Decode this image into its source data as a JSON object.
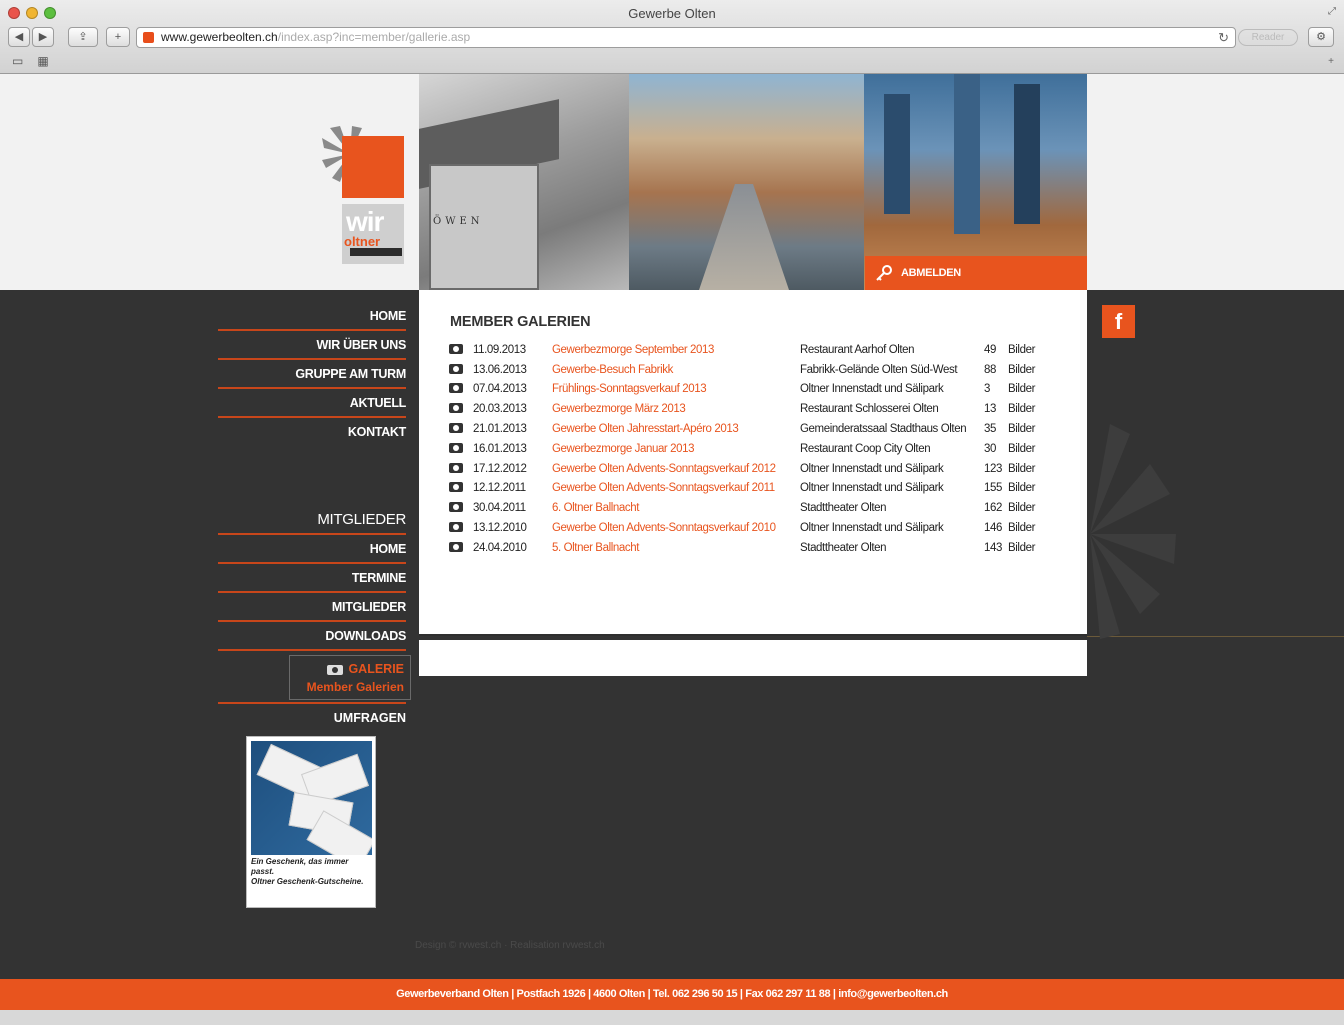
{
  "browser": {
    "window_title": "Gewerbe Olten",
    "url_domain": "www.gewerbeolten.ch",
    "url_path": "/index.asp?inc=member/gallerie.asp",
    "reader_label": "Reader"
  },
  "header": {
    "login_label": "ABMELDEN",
    "logo_word": "wir",
    "logo_sub": "oltner"
  },
  "nav_main": [
    {
      "label": "HOME"
    },
    {
      "label": "WIR ÜBER UNS"
    },
    {
      "label": "GRUPPE AM TURM"
    },
    {
      "label": "AKTUELL"
    },
    {
      "label": "KONTAKT"
    }
  ],
  "members_heading": "MITGLIEDER",
  "nav_members": [
    {
      "label": "HOME"
    },
    {
      "label": "TERMINE"
    },
    {
      "label": "MITGLIEDER"
    },
    {
      "label": "DOWNLOADS"
    }
  ],
  "gallery_nav": {
    "label": "GALERIE",
    "sublabel": "Member Galerien"
  },
  "umfragen_label": "UMFRAGEN",
  "voucher": {
    "caption_line1": "Ein Geschenk, das immer passt.",
    "caption_line2": "Oltner Geschenk-Gutscheine."
  },
  "content": {
    "title": "MEMBER GALERIEN",
    "rows": [
      {
        "date": "11.09.2013",
        "event": "Gewerbezmorge September 2013",
        "location": "Restaurant Aarhof Olten",
        "count": "49",
        "unit": "Bilder"
      },
      {
        "date": "13.06.2013",
        "event": "Gewerbe-Besuch Fabrikk",
        "location": "Fabrikk-Gelände Olten Süd-West",
        "count": "88",
        "unit": "Bilder"
      },
      {
        "date": "07.04.2013",
        "event": "Frühlings-Sonntagsverkauf 2013",
        "location": "Oltner Innenstadt und Sälipark",
        "count": "3",
        "unit": "Bilder"
      },
      {
        "date": "20.03.2013",
        "event": "Gewerbezmorge März 2013",
        "location": "Restaurant Schlosserei Olten",
        "count": "13",
        "unit": "Bilder"
      },
      {
        "date": "21.01.2013",
        "event": "Gewerbe Olten Jahresstart-Apéro 2013",
        "location": "Gemeinderatssaal Stadthaus Olten",
        "count": "35",
        "unit": "Bilder"
      },
      {
        "date": "16.01.2013",
        "event": "Gewerbezmorge Januar 2013",
        "location": "Restaurant Coop City Olten",
        "count": "30",
        "unit": "Bilder"
      },
      {
        "date": "17.12.2012",
        "event": "Gewerbe Olten Advents-Sonntagsverkauf 2012",
        "location": "Oltner Innenstadt und Sälipark",
        "count": "123",
        "unit": "Bilder"
      },
      {
        "date": "12.12.2011",
        "event": "Gewerbe Olten Advents-Sonntagsverkauf 2011",
        "location": "Oltner Innenstadt und Sälipark",
        "count": "155",
        "unit": "Bilder"
      },
      {
        "date": "30.04.2011",
        "event": "6. Oltner Ballnacht",
        "location": "Stadttheater Olten",
        "count": "162",
        "unit": "Bilder"
      },
      {
        "date": "13.12.2010",
        "event": "Gewerbe Olten Advents-Sonntagsverkauf 2010",
        "location": "Oltner Innenstadt und Sälipark",
        "count": "146",
        "unit": "Bilder"
      },
      {
        "date": "24.04.2010",
        "event": "5. Oltner Ballnacht",
        "location": "Stadttheater Olten",
        "count": "143",
        "unit": "Bilder"
      }
    ]
  },
  "facebook_label": "f",
  "credits": "Design © rvwest.ch · Realisation rvwest.ch",
  "footer": "Gewerbeverband Olten | Postfach 1926 | 4600 Olten | Tel. 062 296 50 15 | Fax 062 297 11 88 | info@gewerbeolten.ch",
  "colors": {
    "accent": "#e8541e",
    "dark": "#333333"
  }
}
